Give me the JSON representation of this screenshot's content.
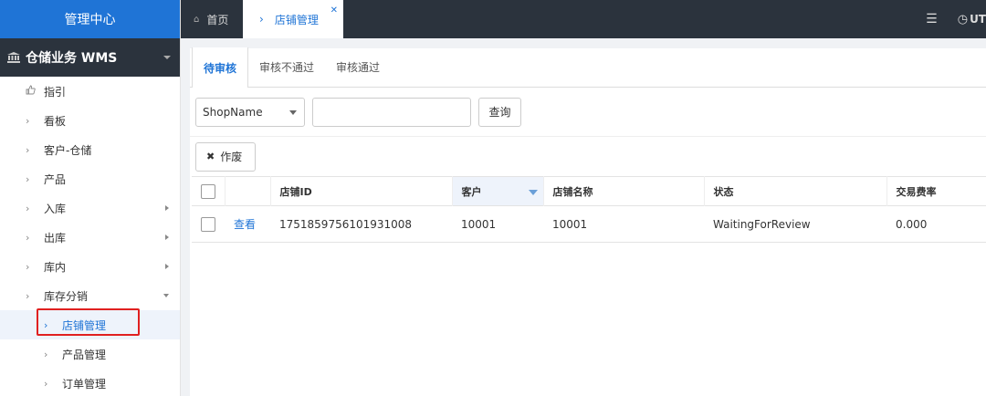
{
  "app": {
    "title": "管理中心"
  },
  "module": {
    "label": "仓储业务 WMS"
  },
  "sidebar": {
    "items": [
      {
        "label": "指引",
        "icon": "thumbs-up-icon"
      },
      {
        "label": "看板"
      },
      {
        "label": "客户-仓储"
      },
      {
        "label": "产品"
      },
      {
        "label": "入库",
        "has_children": true
      },
      {
        "label": "出库",
        "has_children": true
      },
      {
        "label": "库内",
        "has_children": true
      },
      {
        "label": "库存分销",
        "expanded": true
      }
    ],
    "subitems": [
      {
        "label": "店铺管理",
        "active": true
      },
      {
        "label": "产品管理"
      },
      {
        "label": "订单管理"
      }
    ]
  },
  "topbar": {
    "tabs": [
      {
        "label": "首页"
      },
      {
        "label": "店铺管理"
      }
    ],
    "timezone": "UT"
  },
  "subtabs": [
    "待审核",
    "审核不通过",
    "审核通过"
  ],
  "filter": {
    "select_value": "ShopName",
    "input_value": "",
    "query_label": "查询"
  },
  "actions": {
    "void_label": "作废"
  },
  "table": {
    "columns": [
      "店铺ID",
      "客户",
      "店铺名称",
      "状态",
      "交易费率"
    ],
    "rows": [
      {
        "action": "查看",
        "shop_id": "1751859756101931008",
        "customer": "10001",
        "shop_name": "10001",
        "status": "WaitingForReview",
        "fee_rate": "0.000"
      }
    ]
  },
  "colors": {
    "accent": "#1f74d6",
    "dark": "#2b333d",
    "highlight": "#e02020"
  }
}
